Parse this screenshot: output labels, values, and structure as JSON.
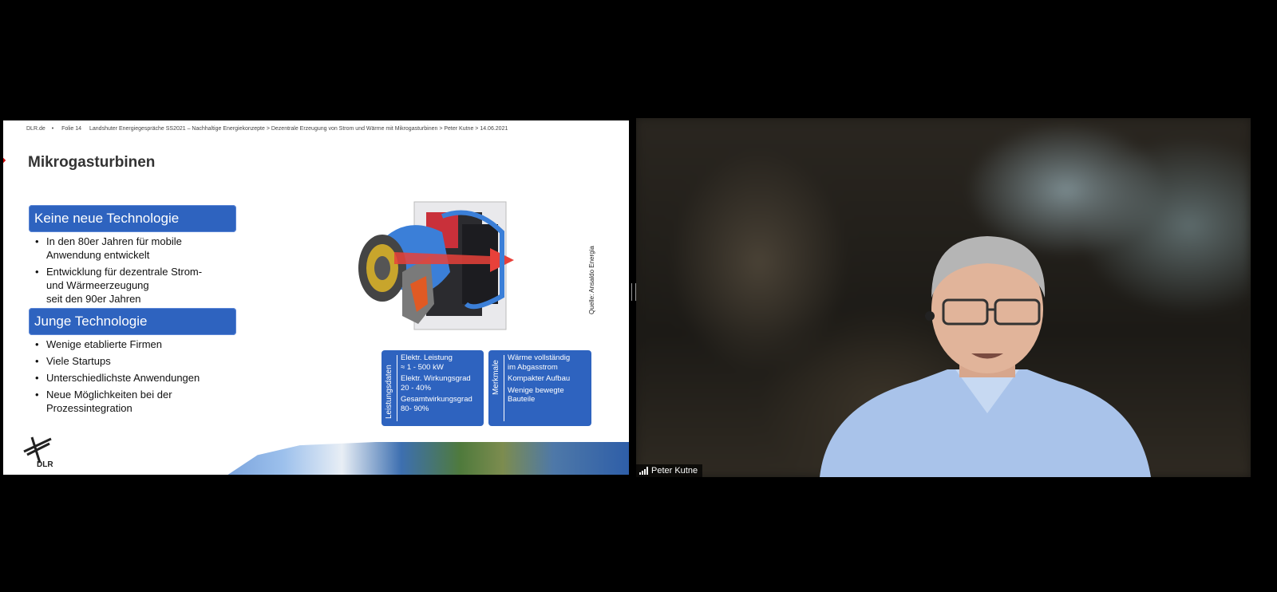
{
  "slide": {
    "header": {
      "site": "DLR.de",
      "slide_no": "Folie 14",
      "path": "Landshuter Energiegespräche SS2021 – Nachhaltige Energiekonzepte > Dezentrale Erzeugung von Strom und Wärme mit Mikrogasturbinen > Peter Kutne > 14.06.2021"
    },
    "title": "Mikrogasturbinen",
    "section1": {
      "heading": "Keine neue Technologie",
      "bullets": [
        "In den 80er Jahren für mobile\nAnwendung entwickelt",
        "Entwicklung für dezentrale Strom-\nund Wärmeerzeugung\nseit den 90er Jahren"
      ]
    },
    "section2": {
      "heading": "Junge Technologie",
      "bullets": [
        "Wenige etablierte Firmen",
        "Viele Startups",
        "Unterschiedlichste Anwendungen",
        "Neue Möglichkeiten bei der\nProzessintegration"
      ]
    },
    "source": "Quelle: Ansaldo Energia",
    "leistungsdaten": {
      "label": "Leistungsdaten",
      "lines": [
        "Elektr. Leistung",
        "≈ 1 - 500 kW",
        "Elektr. Wirkungsgrad",
        "20 - 40%",
        "Gesamtwirkungsgrad",
        "80- 90%"
      ]
    },
    "merkmale": {
      "label": "Merkmale",
      "lines": [
        "Wärme vollständig",
        "im Abgasstrom",
        "Kompakter Aufbau",
        "Wenige bewegte",
        "Bauteile"
      ]
    },
    "logo_text": "DLR"
  },
  "participant": {
    "name": "Peter Kutne"
  },
  "colors": {
    "accent_blue": "#2e63bf",
    "background": "#000000"
  }
}
